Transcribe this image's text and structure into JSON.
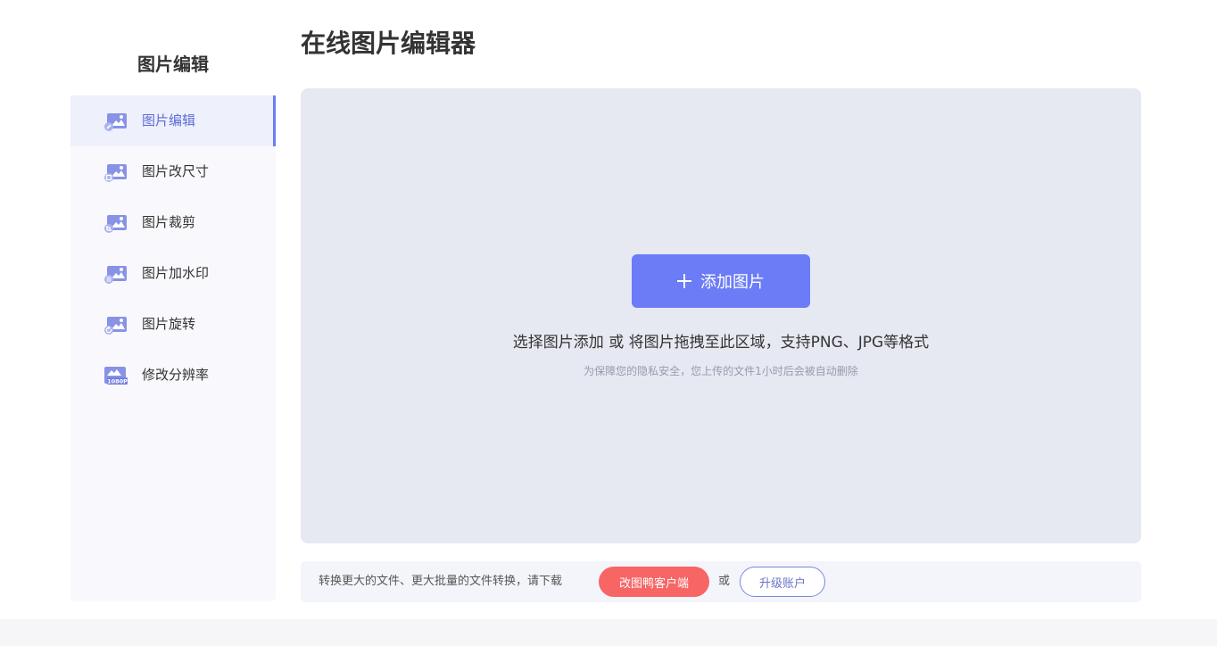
{
  "sidebar": {
    "title": "图片编辑",
    "items": [
      {
        "label": "图片编辑",
        "icon": "image-edit-icon",
        "active": true
      },
      {
        "label": "图片改尺寸",
        "icon": "image-resize-icon",
        "active": false
      },
      {
        "label": "图片裁剪",
        "icon": "image-crop-icon",
        "active": false
      },
      {
        "label": "图片加水印",
        "icon": "image-watermark-icon",
        "active": false
      },
      {
        "label": "图片旋转",
        "icon": "image-rotate-icon",
        "active": false
      },
      {
        "label": "修改分辨率",
        "icon": "resolution-icon",
        "active": false
      }
    ],
    "icon_badges": [
      "",
      "",
      "",
      "",
      "",
      "1080P"
    ]
  },
  "main": {
    "title": "在线图片编辑器",
    "upload": {
      "button_label": "添加图片",
      "hint": "选择图片添加 或 将图片拖拽至此区域，支持PNG、JPG等格式",
      "privacy_note": "为保障您的隐私安全，您上传的文件1小时后会被自动删除"
    },
    "bottom_bar": {
      "text": "转换更大的文件、更大批量的文件转换，请下载",
      "client_button": "改图鸭客户端",
      "or": "或",
      "upgrade_button": "升级账户"
    }
  },
  "colors": {
    "accent": "#6b7cf6",
    "client_button": "#f76565",
    "upload_bg": "#e6e9f1"
  }
}
